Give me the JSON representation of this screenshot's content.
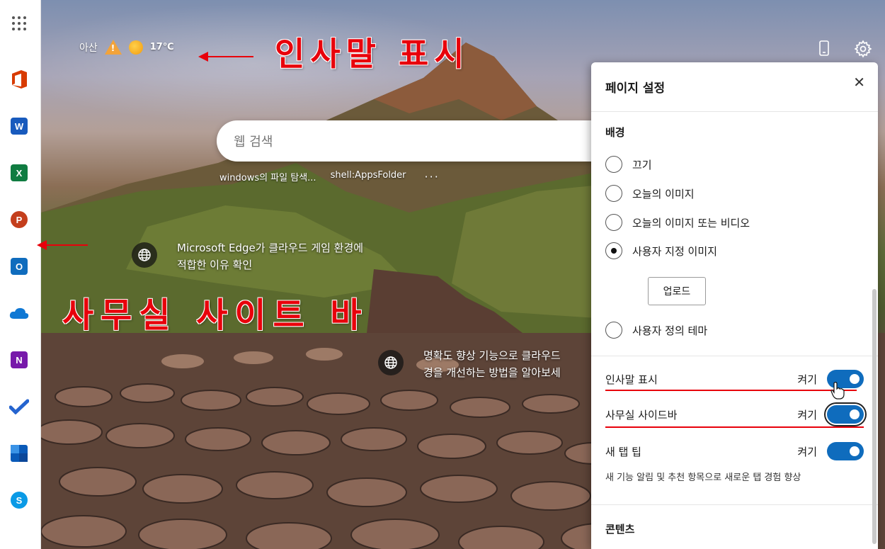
{
  "weather": {
    "location": "아산",
    "temperature": "17℃"
  },
  "annotations": {
    "greeting": "인사말 표시",
    "office_sidebar": "사무실 사이트 바"
  },
  "search": {
    "placeholder": "웹 검색"
  },
  "quicklinks": [
    "windows의 파일 탐색...",
    "shell:AppsFolder",
    "···"
  ],
  "info_cards": [
    {
      "line1": "Microsoft Edge가 클라우드 게임 환경에",
      "line2": "적합한 이유 확인"
    },
    {
      "line1": "명확도 향상 기능으로 클라우드",
      "line2": "경을 개선하는 방법을 알아보세"
    }
  ],
  "sidebar": {
    "apps": [
      "office",
      "word",
      "excel",
      "powerpoint",
      "outlook",
      "onedrive",
      "onenote",
      "todo",
      "family",
      "skype"
    ]
  },
  "panel": {
    "title": "페이지 설정",
    "background_section": "배경",
    "background_options": [
      "끄기",
      "오늘의 이미지",
      "오늘의 이미지 또는 비디오",
      "사용자 지정 이미지",
      "사용자 정의 테마"
    ],
    "selected_option": "사용자 지정 이미지",
    "upload_label": "업로드",
    "toggles": [
      {
        "label": "인사말 표시",
        "state": "켜기"
      },
      {
        "label": "사무실 사이드바",
        "state": "켜기"
      },
      {
        "label": "새 탭 팁",
        "state": "켜기"
      }
    ],
    "tips_description": "새 기능 알림 및 추천 항목으로 새로운 탭 경험 향상",
    "content_section": "콘텐츠"
  },
  "colors": {
    "accent": "#0f6cbd",
    "annotation": "#e8000b"
  }
}
